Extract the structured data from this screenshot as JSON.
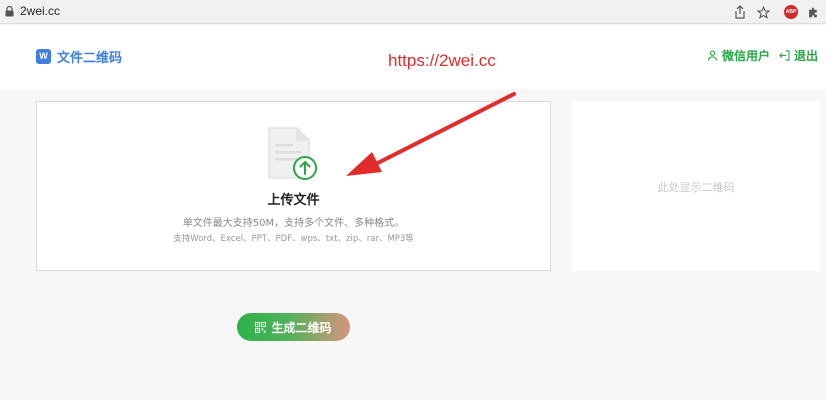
{
  "browser": {
    "url": "2wei.cc",
    "extension_badge": "ABP",
    "icons": [
      "lock-icon",
      "share-icon",
      "star-icon",
      "adblock-icon",
      "puzzle-icon"
    ]
  },
  "header": {
    "logo_mark": "W",
    "logo_text": "文件二维码",
    "user_label": "微信用户",
    "logout_label": "退出"
  },
  "annotation": {
    "url_text": "https://2wei.cc",
    "color": "#e22c2c"
  },
  "upload": {
    "title": "上传文件",
    "description": "单文件最大支持50M，支持多个文件、多种格式。",
    "formats": "支持Word、Excel、PPT、PDF、wps、txt、zip、rar、MP3等",
    "icon": "file-upload-icon"
  },
  "qr_preview": {
    "placeholder": "此处显示二维码"
  },
  "actions": {
    "generate_label": "生成二维码"
  },
  "colors": {
    "brand_blue": "#3d7fe0",
    "brand_green": "#28a745",
    "annotation_red": "#e22c2c"
  }
}
